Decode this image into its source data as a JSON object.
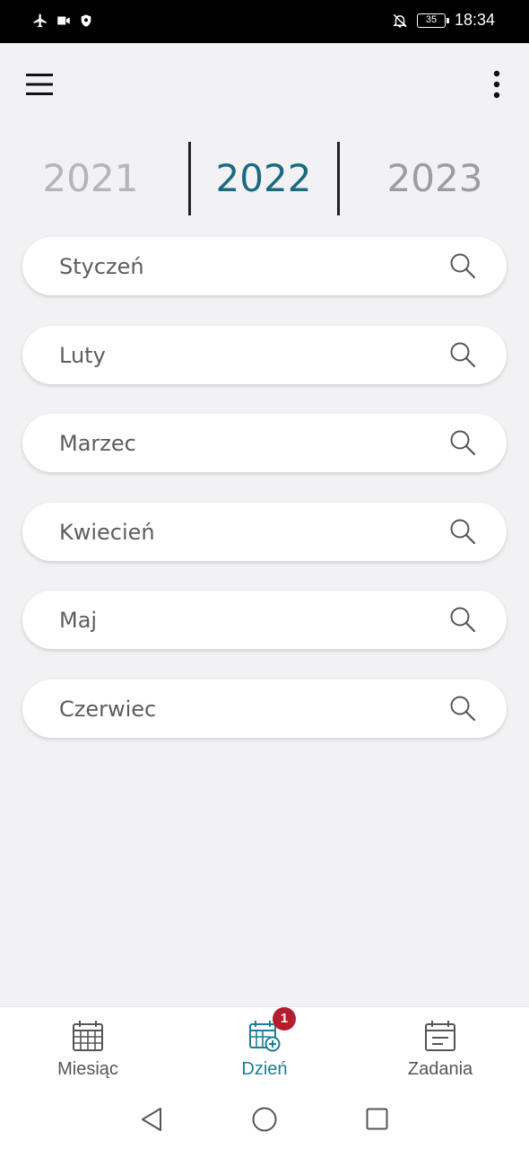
{
  "status_bar": {
    "time": "18:34",
    "battery": "35",
    "icons": [
      "airplane-icon",
      "video-camera-icon",
      "shield-icon",
      "notifications-off-icon",
      "battery-icon"
    ]
  },
  "app_bar": {
    "icons": [
      "menu-icon",
      "more-vertical-icon"
    ]
  },
  "years": {
    "previous": "2021",
    "current": "2022",
    "next": "2023"
  },
  "months": [
    {
      "label": "Styczeń"
    },
    {
      "label": "Luty"
    },
    {
      "label": "Marzec"
    },
    {
      "label": "Kwiecień"
    },
    {
      "label": "Maj"
    },
    {
      "label": "Czerwiec"
    }
  ],
  "bottom_nav": {
    "items": [
      {
        "label": "Miesiąc",
        "icon": "calendar-grid-icon"
      },
      {
        "label": "Dzień",
        "icon": "calendar-add-icon",
        "badge": "1",
        "active": true
      },
      {
        "label": "Zadania",
        "icon": "tasks-calendar-icon"
      }
    ]
  },
  "colors": {
    "accent": "#1b6a81",
    "badge": "#b61d2c",
    "background": "#f2f1f4"
  }
}
